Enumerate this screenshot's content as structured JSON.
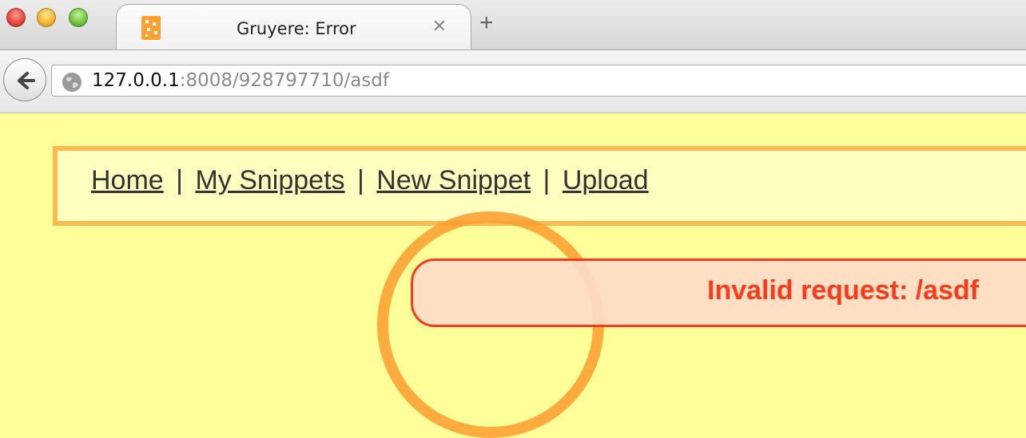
{
  "window": {
    "tab_title": "Gruyere: Error",
    "tab_close_glyph": "✕",
    "new_tab_glyph": "+",
    "favicon_icon": "cheese-icon"
  },
  "address_bar": {
    "host": "127.0.0.1",
    "path": ":8008/928797710/asdf"
  },
  "menu": {
    "items": [
      "Home",
      "My Snippets",
      "New Snippet",
      "Upload"
    ],
    "separator": "|"
  },
  "error": {
    "message": "Invalid request: /asdf"
  },
  "colors": {
    "page_bg": "#ffff99",
    "menu_border": "#ffb950",
    "error_red": "#ff3a1a",
    "ring_orange": "#ff9c2e"
  }
}
